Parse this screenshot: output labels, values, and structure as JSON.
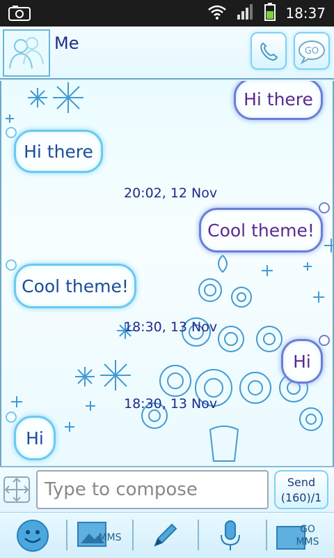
{
  "status_bar": {
    "time": "18:37"
  },
  "header": {
    "contact_name": "Me"
  },
  "messages": [
    {
      "text": "Hi there",
      "direction": "outgoing"
    },
    {
      "text": "Hi there",
      "direction": "incoming"
    },
    {
      "timestamp": "20:02, 12 Nov"
    },
    {
      "text": "Cool theme!",
      "direction": "outgoing"
    },
    {
      "text": "Cool theme!",
      "direction": "incoming"
    },
    {
      "timestamp": "18:30, 13 Nov"
    },
    {
      "text": "Hi",
      "direction": "outgoing"
    },
    {
      "timestamp": "18:30, 13 Nov"
    },
    {
      "text": "Hi",
      "direction": "incoming"
    }
  ],
  "compose": {
    "placeholder": "Type to compose",
    "send_label": "Send",
    "counter": "(160)/1"
  },
  "toolbar": {
    "mms_label": "MMS",
    "go_mms_line1": "GO",
    "go_mms_line2": "MMS"
  },
  "colors": {
    "accent": "#6cc8f0",
    "text_incoming": "#1a4c9a",
    "text_outgoing": "#5b2a8e",
    "timestamp": "#1f2a8a"
  }
}
